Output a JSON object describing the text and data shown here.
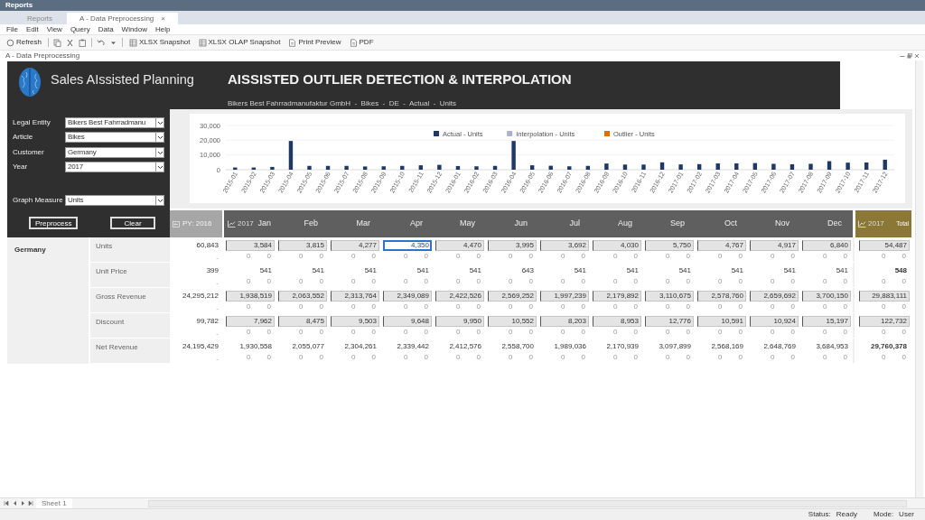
{
  "window": {
    "title": "Reports"
  },
  "tabs": [
    {
      "label": "Reports",
      "selected": false
    },
    {
      "label": "A - Data Preprocessing",
      "selected": true,
      "close": "×"
    }
  ],
  "menu": [
    "File",
    "Edit",
    "View",
    "Query",
    "Data",
    "Window",
    "Help"
  ],
  "toolbar": [
    "Refresh",
    "XLSX Snapshot",
    "XLSX OLAP Snapshot",
    "Print Preview",
    "PDF"
  ],
  "document": {
    "title": "A - Data Preprocessing"
  },
  "banner": {
    "app_name": "Sales AIssisted Planning",
    "title": "AISSISTED OUTLIER DETECTION & INTERPOLATION",
    "subtitle": "Bikers Best Fahrradmanufaktur GmbH  -  Bikes  -  DE  -  Actual  -  Units"
  },
  "filters": [
    {
      "label": "Legal Entity",
      "value": "Bikers Best Fahrradmanu"
    },
    {
      "label": "Article",
      "value": "Bikes"
    },
    {
      "label": "Customer",
      "value": "Germany"
    },
    {
      "label": "Year",
      "value": "2017"
    }
  ],
  "graph_measure": {
    "label": "Graph Measure",
    "value": "Units"
  },
  "buttons": [
    "Preprocess",
    "Clear"
  ],
  "chart": {
    "chart_data": {
      "type": "bar",
      "categories": [
        "2015-01",
        "2015-02",
        "2015-03",
        "2015-04",
        "2015-05",
        "2015-06",
        "2015-07",
        "2015-08",
        "2015-09",
        "2015-10",
        "2015-11",
        "2015-12",
        "2016-01",
        "2016-02",
        "2016-03",
        "2016-04",
        "2016-05",
        "2016-06",
        "2016-07",
        "2016-08",
        "2016-09",
        "2016-10",
        "2016-11",
        "2016-12",
        "2017-01",
        "2017-02",
        "2017-03",
        "2017-04",
        "2017-05",
        "2017-06",
        "2017-07",
        "2017-08",
        "2017-09",
        "2017-10",
        "2017-11",
        "2017-12"
      ],
      "series": [
        {
          "name": "Actual - Units",
          "color": "#1f3864",
          "values": [
            1500,
            1500,
            1900,
            19500,
            2600,
            2600,
            2600,
            2200,
            2300,
            2600,
            3000,
            3300,
            2500,
            2300,
            2600,
            19500,
            3000,
            2700,
            2300,
            2600,
            4200,
            3500,
            3500,
            5000,
            3600,
            3800,
            4300,
            4300,
            4500,
            4000,
            3700,
            4000,
            5800,
            4800,
            4900,
            6800
          ]
        },
        {
          "name": "Interpolation - Units",
          "color": "#a9b3cf",
          "values": [
            null,
            null,
            null,
            null,
            null,
            null,
            null,
            null,
            null,
            null,
            null,
            null,
            null,
            null,
            null,
            null,
            null,
            null,
            null,
            null,
            null,
            null,
            null,
            null,
            null,
            null,
            null,
            null,
            null,
            null,
            null,
            null,
            null,
            null,
            null,
            null
          ]
        },
        {
          "name": "Outlier - Units",
          "color": "#e46c0a",
          "values": [
            null,
            null,
            null,
            null,
            null,
            null,
            null,
            null,
            null,
            null,
            null,
            null,
            null,
            null,
            null,
            null,
            null,
            null,
            null,
            null,
            null,
            null,
            null,
            null,
            null,
            null,
            null,
            null,
            null,
            null,
            null,
            null,
            null,
            null,
            null,
            null
          ]
        }
      ],
      "ylim": [
        0,
        30000
      ],
      "yticks": [
        {
          "value": 0,
          "label": "0"
        },
        {
          "value": 10000,
          "label": "10,000"
        },
        {
          "value": 20000,
          "label": "20,000"
        },
        {
          "value": 30000,
          "label": "30,000"
        }
      ]
    }
  },
  "table": {
    "py_header": "PY: 2016",
    "year": "2017",
    "months": [
      "Jan",
      "Feb",
      "Mar",
      "Apr",
      "May",
      "Jun",
      "Jul",
      "Aug",
      "Sep",
      "Oct",
      "Nov",
      "Dec"
    ],
    "total_year": "2017",
    "total_header": "Total",
    "group_label": "Germany",
    "rows": [
      {
        "label": "Units",
        "kind": "input",
        "py": "60,843",
        "py_note": "-",
        "cells": [
          {
            "value": "3,584",
            "notes": [
              "0",
              "0"
            ],
            "selected": false
          },
          {
            "value": "3,815",
            "notes": [
              "0",
              "0"
            ],
            "selected": false
          },
          {
            "value": "4,277",
            "notes": [
              "0",
              "0"
            ],
            "selected": false
          },
          {
            "value": "4,350",
            "notes": [
              "0",
              "0"
            ],
            "selected": true
          },
          {
            "value": "4,470",
            "notes": [
              "0",
              "0"
            ],
            "selected": false
          },
          {
            "value": "3,995",
            "notes": [
              "0",
              "0"
            ],
            "selected": false
          },
          {
            "value": "3,692",
            "notes": [
              "0",
              "0"
            ],
            "selected": false
          },
          {
            "value": "4,030",
            "notes": [
              "0",
              "0"
            ],
            "selected": false
          },
          {
            "value": "5,750",
            "notes": [
              "0",
              "0"
            ],
            "selected": false
          },
          {
            "value": "4,767",
            "notes": [
              "0",
              "0"
            ],
            "selected": false
          },
          {
            "value": "4,917",
            "notes": [
              "0",
              "0"
            ],
            "selected": false
          },
          {
            "value": "6,840",
            "notes": [
              "0",
              "0"
            ],
            "selected": false
          }
        ],
        "total": {
          "value": "54,487",
          "notes": [
            "0",
            "0"
          ]
        }
      },
      {
        "label": "Unit Price",
        "kind": "plain",
        "py": "399",
        "py_note": "-",
        "cells": [
          {
            "value": "541",
            "notes": [
              "0",
              "0"
            ]
          },
          {
            "value": "541",
            "notes": [
              "0",
              "0"
            ]
          },
          {
            "value": "541",
            "notes": [
              "0",
              "0"
            ]
          },
          {
            "value": "541",
            "notes": [
              "0",
              "0"
            ]
          },
          {
            "value": "541",
            "notes": [
              "0",
              "0"
            ]
          },
          {
            "value": "643",
            "notes": [
              "0",
              "0"
            ]
          },
          {
            "value": "541",
            "notes": [
              "0",
              "0"
            ]
          },
          {
            "value": "541",
            "notes": [
              "0",
              "0"
            ]
          },
          {
            "value": "541",
            "notes": [
              "0",
              "0"
            ]
          },
          {
            "value": "541",
            "notes": [
              "0",
              "0"
            ]
          },
          {
            "value": "541",
            "notes": [
              "0",
              "0"
            ]
          },
          {
            "value": "541",
            "notes": [
              "0",
              "0"
            ]
          }
        ],
        "total": {
          "value": "548",
          "notes": [
            "0",
            "0"
          ]
        }
      },
      {
        "label": "Gross Revenue",
        "kind": "input",
        "py": "24,295,212",
        "py_note": "-",
        "cells": [
          {
            "value": "1,938,519",
            "notes": [
              "0",
              "0"
            ],
            "selected": false
          },
          {
            "value": "2,063,552",
            "notes": [
              "0",
              "0"
            ],
            "selected": false
          },
          {
            "value": "2,313,764",
            "notes": [
              "0",
              "0"
            ],
            "selected": false
          },
          {
            "value": "2,349,089",
            "notes": [
              "0",
              "0"
            ],
            "selected": false
          },
          {
            "value": "2,422,526",
            "notes": [
              "0",
              "0"
            ],
            "selected": false
          },
          {
            "value": "2,569,252",
            "notes": [
              "0",
              "0"
            ],
            "selected": false
          },
          {
            "value": "1,997,239",
            "notes": [
              "0",
              "0"
            ],
            "selected": false
          },
          {
            "value": "2,179,892",
            "notes": [
              "0",
              "0"
            ],
            "selected": false
          },
          {
            "value": "3,110,675",
            "notes": [
              "0",
              "0"
            ],
            "selected": false
          },
          {
            "value": "2,578,760",
            "notes": [
              "0",
              "0"
            ],
            "selected": false
          },
          {
            "value": "2,659,692",
            "notes": [
              "0",
              "0"
            ],
            "selected": false
          },
          {
            "value": "3,700,150",
            "notes": [
              "0",
              "0"
            ],
            "selected": false
          }
        ],
        "total": {
          "value": "29,883,111",
          "notes": [
            "0",
            "0"
          ]
        }
      },
      {
        "label": "Discount",
        "kind": "input",
        "py": "99,782",
        "py_note": "-",
        "cells": [
          {
            "value": "7,962",
            "notes": [
              "0",
              "0"
            ],
            "selected": false
          },
          {
            "value": "8,475",
            "notes": [
              "0",
              "0"
            ],
            "selected": false
          },
          {
            "value": "9,503",
            "notes": [
              "0",
              "0"
            ],
            "selected": false
          },
          {
            "value": "9,648",
            "notes": [
              "0",
              "0"
            ],
            "selected": false
          },
          {
            "value": "9,950",
            "notes": [
              "0",
              "0"
            ],
            "selected": false
          },
          {
            "value": "10,552",
            "notes": [
              "0",
              "0"
            ],
            "selected": false
          },
          {
            "value": "8,203",
            "notes": [
              "0",
              "0"
            ],
            "selected": false
          },
          {
            "value": "8,953",
            "notes": [
              "0",
              "0"
            ],
            "selected": false
          },
          {
            "value": "12,776",
            "notes": [
              "0",
              "0"
            ],
            "selected": false
          },
          {
            "value": "10,591",
            "notes": [
              "0",
              "0"
            ],
            "selected": false
          },
          {
            "value": "10,924",
            "notes": [
              "0",
              "0"
            ],
            "selected": false
          },
          {
            "value": "15,197",
            "notes": [
              "0",
              "0"
            ],
            "selected": false
          }
        ],
        "total": {
          "value": "122,732",
          "notes": [
            "0",
            "0"
          ]
        }
      },
      {
        "label": "Net Revenue",
        "kind": "plain",
        "py": "24,195,429",
        "py_note": "-",
        "cells": [
          {
            "value": "1,930,558",
            "notes": [
              "0",
              "0"
            ]
          },
          {
            "value": "2,055,077",
            "notes": [
              "0",
              "0"
            ]
          },
          {
            "value": "2,304,261",
            "notes": [
              "0",
              "0"
            ]
          },
          {
            "value": "2,339,442",
            "notes": [
              "0",
              "0"
            ]
          },
          {
            "value": "2,412,576",
            "notes": [
              "0",
              "0"
            ]
          },
          {
            "value": "2,558,700",
            "notes": [
              "0",
              "0"
            ]
          },
          {
            "value": "1,989,036",
            "notes": [
              "0",
              "0"
            ]
          },
          {
            "value": "2,170,939",
            "notes": [
              "0",
              "0"
            ]
          },
          {
            "value": "3,097,899",
            "notes": [
              "0",
              "0"
            ]
          },
          {
            "value": "2,568,169",
            "notes": [
              "0",
              "0"
            ]
          },
          {
            "value": "2,648,769",
            "notes": [
              "0",
              "0"
            ]
          },
          {
            "value": "3,684,953",
            "notes": [
              "0",
              "0"
            ]
          }
        ],
        "total": {
          "value": "29,760,378",
          "notes": [
            "0",
            "0"
          ]
        }
      }
    ]
  },
  "sheets": [
    {
      "label": "Sheet 1",
      "selected": true
    }
  ],
  "status_bar": {
    "status_label": "Status:",
    "status": "Ready",
    "mode_label": "Mode:",
    "mode": "User"
  }
}
